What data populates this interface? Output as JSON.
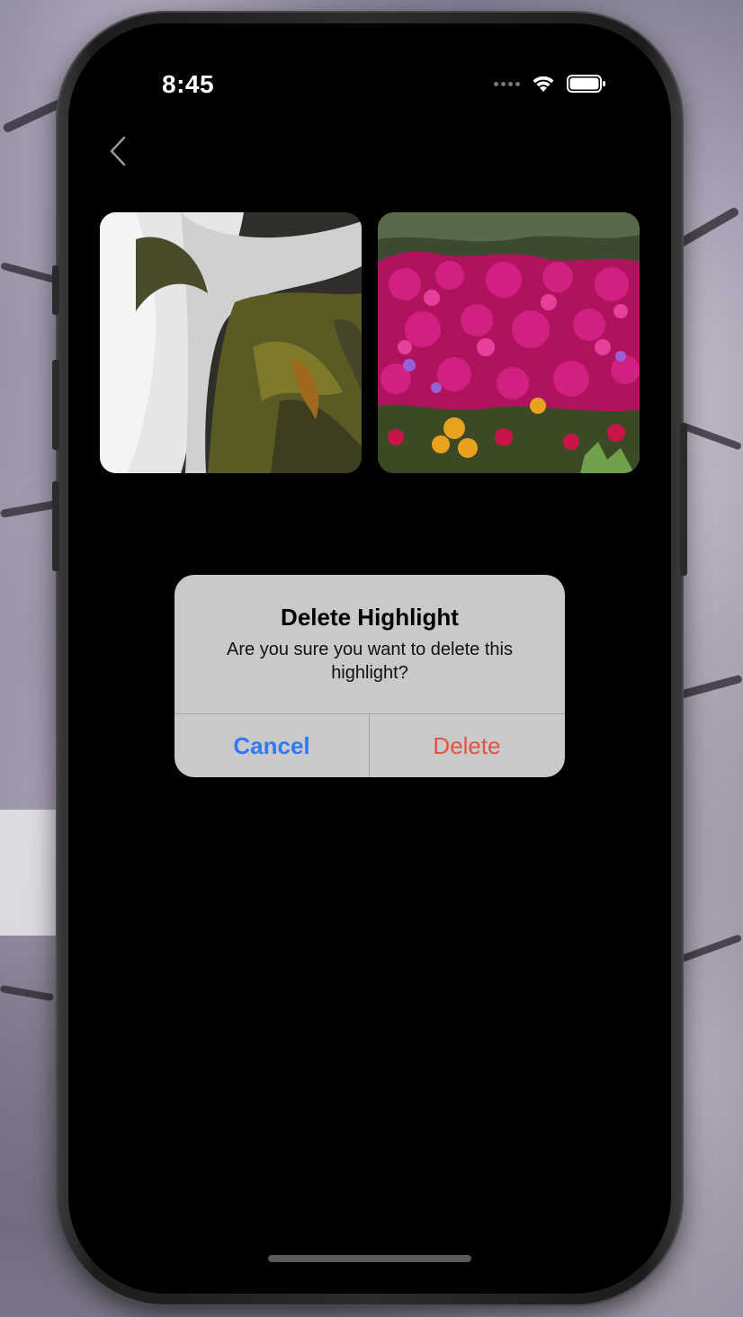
{
  "status_bar": {
    "time": "8:45",
    "icons": [
      "signal-dots-icon",
      "wifi-icon",
      "battery-icon"
    ]
  },
  "nav": {
    "back_icon": "chevron-left-icon"
  },
  "highlights": [
    {
      "subject": "waterfall"
    },
    {
      "subject": "magenta flowers"
    }
  ],
  "alert": {
    "title": "Delete Highlight",
    "message": "Are you sure you want to delete this highlight?",
    "cancel_label": "Cancel",
    "delete_label": "Delete"
  },
  "colors": {
    "cancel": "#3478f6",
    "delete": "#e5533f",
    "alert_bg": "#c9c9cb",
    "screen_bg": "#000000"
  }
}
